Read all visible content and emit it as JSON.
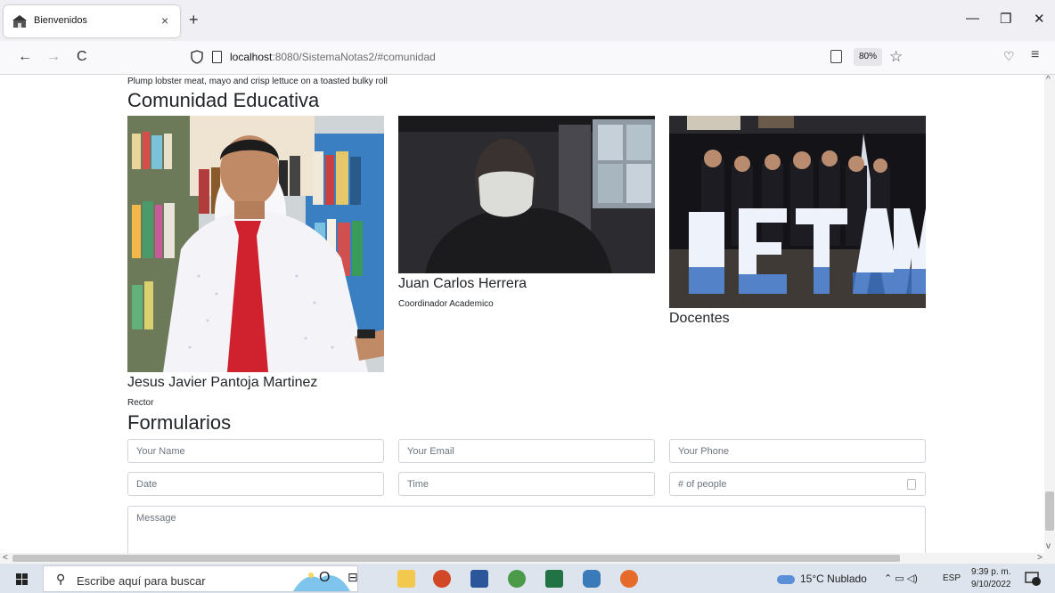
{
  "browser": {
    "tab_title": "Bienvenidos",
    "tab_close": "×",
    "new_tab": "+",
    "url_host": "localhost",
    "url_rest": ":8080/SistemaNotas2/#comunidad",
    "zoom": "80%",
    "back": "←",
    "forward": "→",
    "reload": "C",
    "minimize": "—",
    "restore": "❐",
    "close": "✕"
  },
  "page": {
    "snippet": "Plump lobster meat, mayo and crisp lettuce on a toasted bulky roll",
    "community_title": "Comunidad Educativa",
    "members": [
      {
        "name": "Jesus Javier Pantoja Martinez",
        "role": "Rector"
      },
      {
        "name": "Juan Carlos Herrera",
        "role": "Coordinador Academico"
      },
      {
        "name": "Docentes"
      }
    ],
    "banner_text": "IETAM",
    "forms_title": "Formularios",
    "form": {
      "name_placeholder": "Your Name",
      "email_placeholder": "Your Email",
      "phone_placeholder": "Your Phone",
      "date_placeholder": "Date",
      "time_placeholder": "Time",
      "people_placeholder": "# of people",
      "message_placeholder": "Message"
    }
  },
  "taskbar": {
    "search_placeholder": "Escribe aquí para buscar",
    "weather": "15°C  Nublado",
    "language": "ESP",
    "time": "9:39 p. m.",
    "date": "9/10/2022",
    "notifications": "18"
  },
  "colors": {
    "accent_chrome": "#f0f0f4",
    "taskbar": "#dde4ee",
    "tie_red": "#d0212f"
  }
}
